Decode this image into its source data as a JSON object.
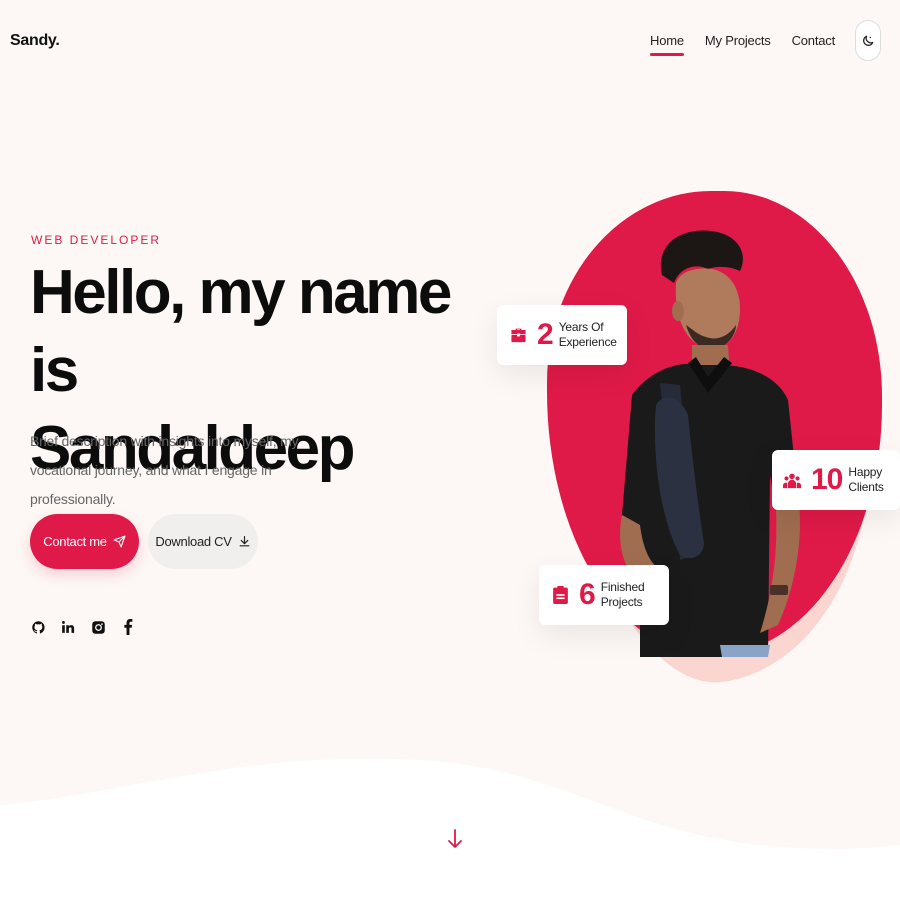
{
  "header": {
    "logo": "Sandy.",
    "nav": [
      {
        "label": "Home",
        "active": true
      },
      {
        "label": "My Projects",
        "active": false
      },
      {
        "label": "Contact",
        "active": false
      }
    ],
    "theme_toggle_icon": "moon-icon"
  },
  "hero": {
    "role": "WEB DEVELOPER",
    "headline_line1": "Hello, my name is",
    "headline_line2": "Sandaldeep",
    "description": "Brief description with insights into myself, my vocational journey, and what I engage in professionally.",
    "contact_label": "Contact me",
    "download_label": "Download CV",
    "socials": [
      "github-icon",
      "linkedin-icon",
      "instagram-icon",
      "facebook-icon"
    ]
  },
  "stats": [
    {
      "value": "2",
      "label": "Years Of Experience",
      "icon": "briefcase-icon"
    },
    {
      "value": "10",
      "label": "Happy Clients",
      "icon": "users-icon"
    },
    {
      "value": "6",
      "label": "Finished Projects",
      "icon": "clipboard-icon"
    }
  ],
  "colors": {
    "accent": "#e01a48",
    "background": "#fdf8f5",
    "blob_light": "#fbd5d0"
  },
  "scroll_icon": "arrow-down-icon"
}
